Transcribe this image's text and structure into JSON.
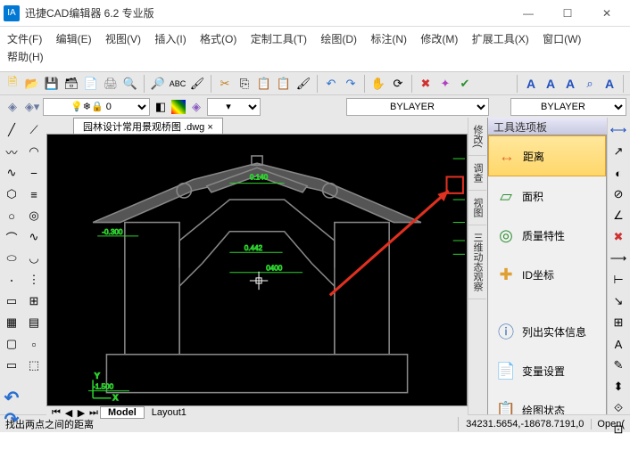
{
  "title": "迅捷CAD编辑器 6.2 专业版",
  "menu": [
    "文件(F)",
    "编辑(E)",
    "视图(V)",
    "插入(I)",
    "格式(O)",
    "定制工具(T)",
    "绘图(D)",
    "标注(N)",
    "修改(M)",
    "扩展工具(X)",
    "窗口(W)",
    "帮助(H)"
  ],
  "layer_sel": "",
  "line_sel1": "BYLAYER",
  "line_sel2": "BYLAYER",
  "doc_tab": "园林设计常用景观桥图 .dwg",
  "model_tabs": [
    "Model",
    "Layout1"
  ],
  "side_tabs": [
    "修改(",
    "调查",
    "视图",
    "三维动态观察"
  ],
  "palette_title": "工具选项板",
  "palette_items": [
    {
      "label": "距离",
      "sel": true,
      "icon": "↔"
    },
    {
      "label": "面积",
      "icon": "▱"
    },
    {
      "label": "质量特性",
      "icon": "◎"
    },
    {
      "label": "ID坐标",
      "icon": "✚"
    },
    {
      "label": "列出实体信息",
      "icon": "ⓘ"
    },
    {
      "label": "变量设置",
      "icon": "📄"
    },
    {
      "label": "绘图状态",
      "icon": "📋"
    }
  ],
  "status_msg": "找出两点之间的距离",
  "status_coord": "34231.5654,-18678.7191,0",
  "status_btn": "Open(",
  "dims": {
    "a": "0.140",
    "b": "0.442",
    "c": "0400",
    "d": "-0.300",
    "e": "-1.500"
  }
}
